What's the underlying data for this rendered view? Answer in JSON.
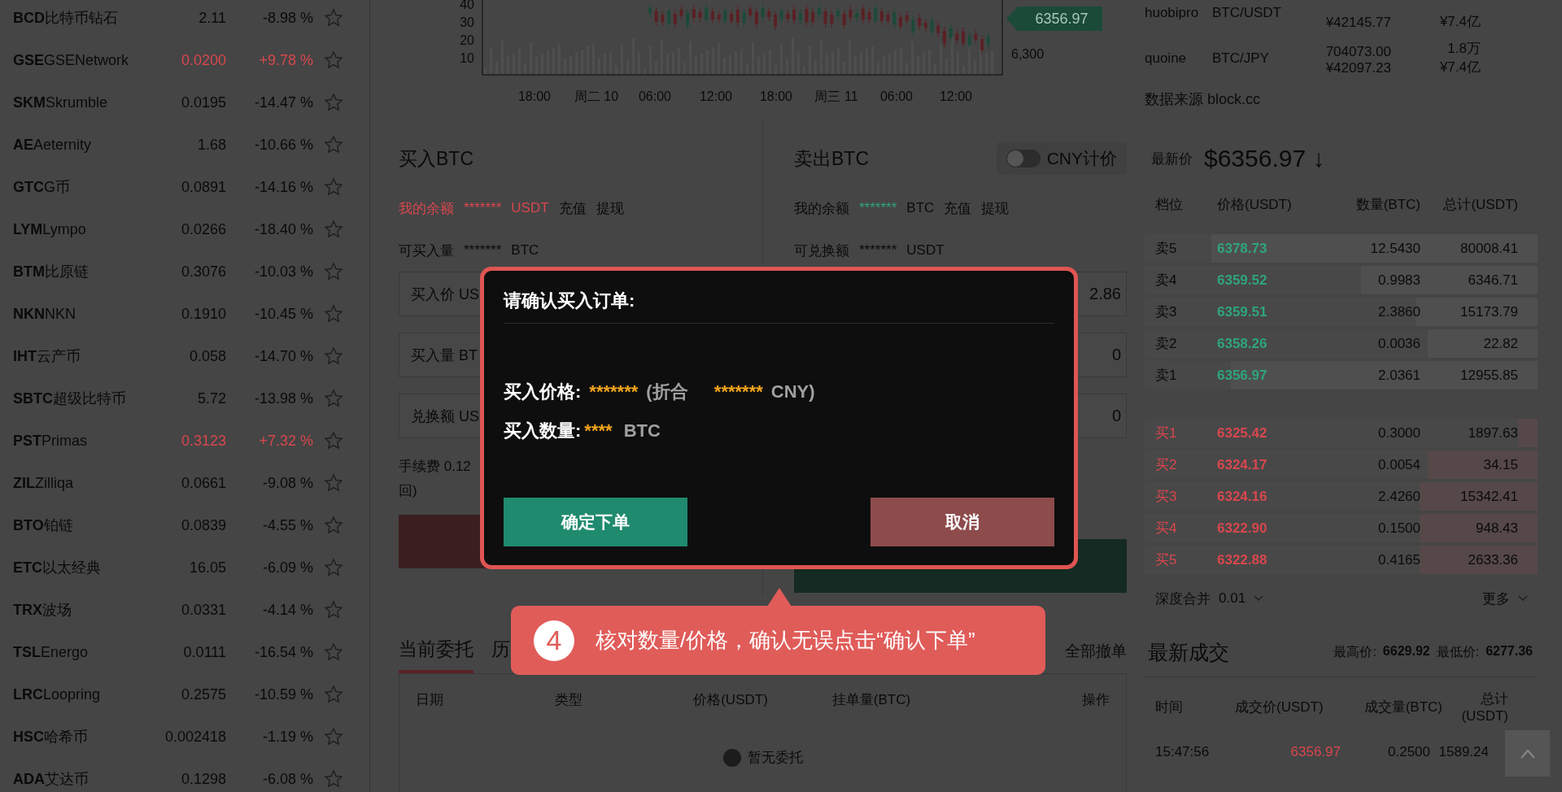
{
  "coin_list": [
    {
      "name": "**BCD**比特币钻石",
      "price": "2.11",
      "change": "-8.98 %",
      "color": "#0a0a0a"
    },
    {
      "name": "**GSE**GSENetwork",
      "price": "0.0200",
      "change": "+9.78 %",
      "color": "#d8474e"
    },
    {
      "name": "**SKM**Skrumble",
      "price": "0.0195",
      "change": "-14.47 %",
      "color": "#0a0a0a"
    },
    {
      "name": "**AE**Aeternity",
      "price": "1.68",
      "change": "-10.66 %",
      "color": "#0a0a0a"
    },
    {
      "name": "**GTC**G币",
      "price": "0.0891",
      "change": "-14.16 %",
      "color": "#0a0a0a"
    },
    {
      "name": "**LYM**Lympo",
      "price": "0.0266",
      "change": "-18.40 %",
      "color": "#0a0a0a"
    },
    {
      "name": "**BTM**比原链",
      "price": "0.3076",
      "change": "-10.03 %",
      "color": "#0a0a0a"
    },
    {
      "name": "**NKN**NKN",
      "price": "0.1910",
      "change": "-10.45 %",
      "color": "#0a0a0a"
    },
    {
      "name": "**IHT**云产币",
      "price": "0.058",
      "change": "-14.70 %",
      "color": "#0a0a0a"
    },
    {
      "name": "**SBTC**超级比特币",
      "price": "5.72",
      "change": "-13.98 %",
      "color": "#0a0a0a"
    },
    {
      "name": "**PST**Primas",
      "price": "0.3123",
      "change": "+7.32 %",
      "color": "#d8474e"
    },
    {
      "name": "**ZIL**Zilliqa",
      "price": "0.0661",
      "change": "-9.08 %",
      "color": "#0a0a0a"
    },
    {
      "name": "**BTO**铂链",
      "price": "0.0839",
      "change": "-4.55 %",
      "color": "#0a0a0a"
    },
    {
      "name": "**ETC**以太经典",
      "price": "16.05",
      "change": "-6.09 %",
      "color": "#0a0a0a"
    },
    {
      "name": "**TRX**波场",
      "price": "0.0331",
      "change": "-4.14 %",
      "color": "#0a0a0a"
    },
    {
      "name": "**TSL**Energo",
      "price": "0.0111",
      "change": "-16.54 %",
      "color": "#0a0a0a"
    },
    {
      "name": "**LRC**Loopring",
      "price": "0.2575",
      "change": "-10.59 %",
      "color": "#0a0a0a"
    },
    {
      "name": "**HSC**哈希币",
      "price": "0.002418",
      "change": "-1.19 %",
      "color": "#0a0a0a"
    },
    {
      "name": "**ADA**艾达币",
      "price": "0.1298",
      "change": "-6.08 %",
      "color": "#0a0a0a"
    }
  ],
  "chart": {
    "y_ticks": [
      "40",
      "30",
      "20",
      "10"
    ],
    "x_labels": [
      "18:00",
      "周二 10",
      "06:00",
      "12:00",
      "18:00",
      "周三 11",
      "06:00",
      "12:00"
    ],
    "price_tag": "6356.97",
    "price_level": "6,300"
  },
  "buy": {
    "title": "买入BTC",
    "balance_label": "我的余额",
    "balance_value": "*******",
    "balance_unit": "USDT",
    "deposit": "充值",
    "withdraw": "提现",
    "available_label": "可买入量",
    "available_value": "*******",
    "available_unit": "BTC",
    "fields": [
      {
        "placeholder": "买入价 US"
      },
      {
        "placeholder": "买入量 BT"
      },
      {
        "placeholder": "兑换额 US"
      }
    ],
    "fee_label": "手续费",
    "fee_value": "0.12",
    "fee_tail": "回)"
  },
  "sell": {
    "title": "卖出BTC",
    "balance_label": "我的余额",
    "balance_value": "*******",
    "balance_unit": "BTC",
    "deposit": "充值",
    "withdraw": "提现",
    "available_label": "可兑换额",
    "available_value": "*******",
    "available_unit": "USDT",
    "fields": [
      {
        "value": "2.86"
      },
      {
        "value": "0"
      },
      {
        "value": "0"
      }
    ]
  },
  "price_toggle": {
    "label": "CNY计价",
    "on": false
  },
  "orders": {
    "tabs": [
      {
        "label": "当前委托",
        "selected": true
      },
      {
        "label": "历",
        "selected": false
      }
    ],
    "cancel_all": "全部撤单",
    "columns": [
      "日期",
      "类型",
      "价格(USDT)",
      "挂单量(BTC)",
      "操作"
    ],
    "empty": "暂无委托"
  },
  "markets": [
    {
      "exchange": "huobipro",
      "pair": "BTC/USDT",
      "price_cny": "¥42145.77",
      "volume_cny": "¥7.4亿"
    },
    {
      "exchange": "quoine",
      "pair": "BTC/JPY",
      "price": "704073.00",
      "price_cny": "¥42097.23",
      "volume": "1.8万",
      "volume_cny": "¥7.4亿"
    }
  ],
  "source": "数据来源 block.cc",
  "latest": {
    "label": "最新价",
    "price": "$6356.97",
    "arrow": "↓"
  },
  "orderbook": {
    "columns": [
      "档位",
      "价格(USDT)",
      "数量(BTC)",
      "总计(USDT)"
    ],
    "rows": [
      {
        "kind": "sell",
        "level_label": "卖5",
        "price": "6378.73",
        "amount": "12.5430",
        "total": "80008.41",
        "level": 0.83
      },
      {
        "kind": "sell",
        "level_label": "卖4",
        "price": "6359.52",
        "amount": "0.9983",
        "total": "6346.71",
        "level": 0.45
      },
      {
        "kind": "sell",
        "level_label": "卖3",
        "price": "6359.51",
        "amount": "2.3860",
        "total": "15173.79",
        "level": 0.31
      },
      {
        "kind": "sell",
        "level_label": "卖2",
        "price": "6358.26",
        "amount": "0.0036",
        "total": "22.82",
        "level": 0.28
      },
      {
        "kind": "sell",
        "level_label": "卖1",
        "price": "6356.97",
        "amount": "2.0361",
        "total": "12955.85",
        "level": 0.78
      },
      {
        "kind": "buy",
        "level_label": "买1",
        "price": "6325.42",
        "amount": "0.3000",
        "total": "1897.63",
        "level": 0.05
      },
      {
        "kind": "buy",
        "level_label": "买2",
        "price": "6324.17",
        "amount": "0.0054",
        "total": "34.15",
        "level": 0.28
      },
      {
        "kind": "buy",
        "level_label": "买3",
        "price": "6324.16",
        "amount": "2.4260",
        "total": "15342.41",
        "level": 0.3
      },
      {
        "kind": "buy",
        "level_label": "买4",
        "price": "6322.90",
        "amount": "0.1500",
        "total": "948.43",
        "level": 0.3
      },
      {
        "kind": "buy",
        "level_label": "买5",
        "price": "6322.88",
        "amount": "0.4165",
        "total": "2633.36",
        "level": 0.3
      }
    ],
    "depth_label": "深度合并",
    "depth_value": "0.01",
    "more": "更多"
  },
  "trades": {
    "title": "最新成交",
    "high_label": "最高价:",
    "high": "6629.92",
    "low_label": "最低价:",
    "low": "6277.36",
    "columns": [
      "时间",
      "成交价(USDT)",
      "成交量(BTC)",
      "总计(USDT)"
    ],
    "rows": [
      {
        "time": "15:47:56",
        "price": "6356.97",
        "amount": "0.2500",
        "total": "1589.24"
      }
    ]
  },
  "dialog": {
    "title": "请确认买入订单:",
    "price_label": "买入价格:",
    "price_value": "*******",
    "cny_open": "(折合",
    "cny_value": "*******",
    "cny_close": "CNY)",
    "qty_label": "买入数量:",
    "qty_value": "****",
    "qty_unit": "BTC",
    "confirm": "确定下单",
    "cancel": "取消"
  },
  "callout": {
    "step": "4",
    "text": "核对数量/价格，确认无误点击“确认下单”"
  }
}
